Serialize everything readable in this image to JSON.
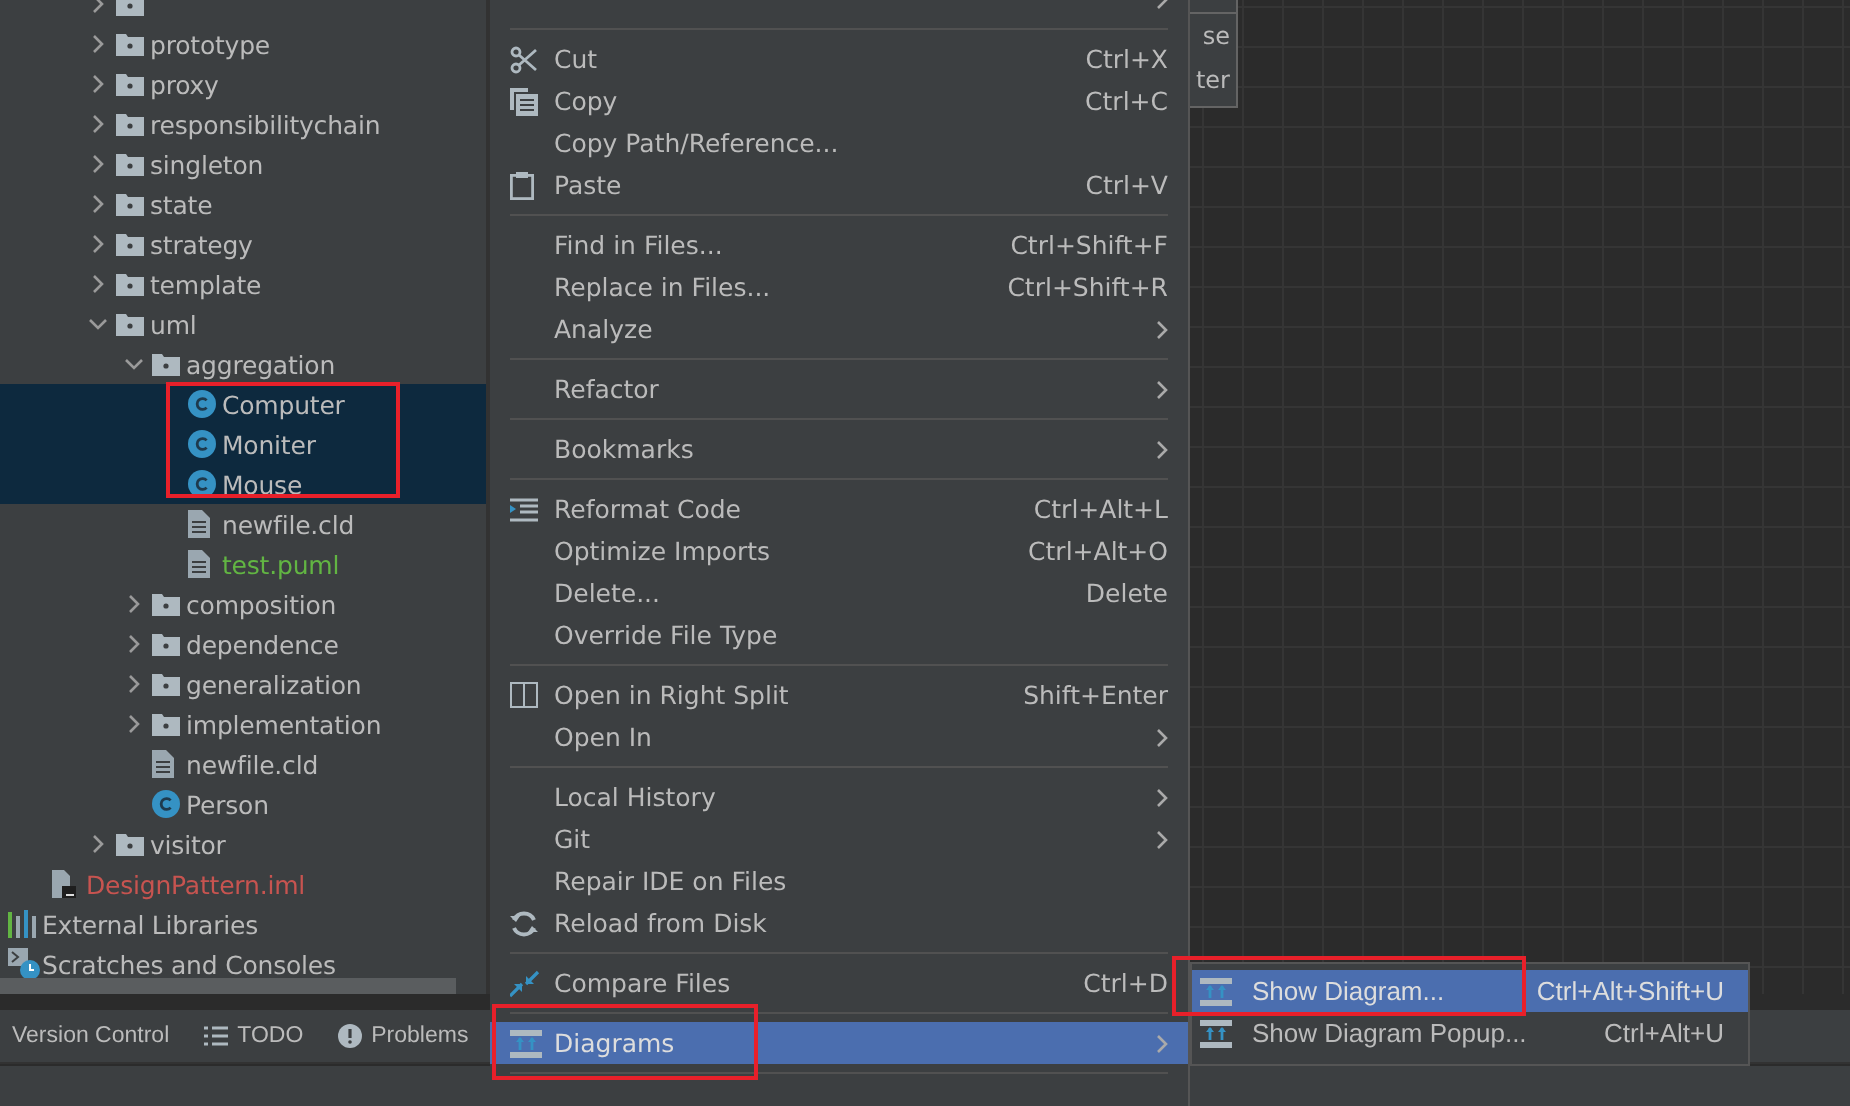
{
  "project_tree": {
    "package_items": [
      {
        "kind": "folder",
        "expanded": false,
        "selected": false
      },
      {
        "label": "prototype",
        "kind": "folder",
        "expanded": false,
        "selected": false
      },
      {
        "label": "proxy",
        "kind": "folder",
        "expanded": false,
        "selected": false
      },
      {
        "label": "responsibilitychain",
        "kind": "folder",
        "expanded": false,
        "selected": false
      },
      {
        "label": "singleton",
        "kind": "folder",
        "expanded": false,
        "selected": false
      },
      {
        "label": "state",
        "kind": "folder",
        "expanded": false,
        "selected": false
      },
      {
        "label": "strategy",
        "kind": "folder",
        "expanded": false,
        "selected": false
      },
      {
        "label": "template",
        "kind": "folder",
        "expanded": false,
        "selected": false
      },
      {
        "label": "uml",
        "kind": "folder",
        "expanded": true,
        "selected": false,
        "children": [
          {
            "label": "aggregation",
            "kind": "folder",
            "expanded": true,
            "selected": false,
            "children": [
              {
                "label": "Computer",
                "kind": "class",
                "selected": true
              },
              {
                "label": "Moniter",
                "kind": "class",
                "selected": true
              },
              {
                "label": "Mouse",
                "kind": "class",
                "selected": true
              },
              {
                "label": "newfile.cld",
                "kind": "file",
                "selected": false
              },
              {
                "label": "test.puml",
                "kind": "file",
                "selected": false,
                "color": "#62b543"
              }
            ]
          },
          {
            "label": "composition",
            "kind": "folder",
            "expanded": false,
            "selected": false
          },
          {
            "label": "dependence",
            "kind": "folder",
            "expanded": false,
            "selected": false
          },
          {
            "label": "generalization",
            "kind": "folder",
            "expanded": false,
            "selected": false
          },
          {
            "label": "implementation",
            "kind": "folder",
            "expanded": false,
            "selected": false
          },
          {
            "label": "newfile.cld",
            "kind": "file",
            "selected": false
          },
          {
            "label": "Person",
            "kind": "class",
            "selected": false
          }
        ]
      },
      {
        "label": "visitor",
        "kind": "folder",
        "expanded": false,
        "selected": false
      }
    ],
    "module_file": {
      "label": "DesignPattern.iml",
      "kind": "module",
      "selected": false,
      "color": "#c75450"
    },
    "root_items": [
      {
        "label": "External Libraries",
        "kind": "libraries",
        "selected": false
      },
      {
        "label": "Scratches and Consoles",
        "kind": "scratches",
        "selected": false
      }
    ]
  },
  "canvas_popup": {
    "lines": [
      "se",
      "ter"
    ]
  },
  "tool_window_bar": {
    "tabs": [
      {
        "label": "Version Control"
      },
      {
        "label": "TODO"
      },
      {
        "label": "Problems"
      }
    ]
  },
  "context_menu": {
    "items": [
      {
        "kind": "item",
        "submenu": true,
        "selected": false
      },
      {
        "kind": "separator"
      },
      {
        "kind": "item",
        "label": "Cut",
        "shortcut": "Ctrl+X",
        "submenu": false,
        "selected": false
      },
      {
        "kind": "item",
        "label": "Copy",
        "shortcut": "Ctrl+C",
        "submenu": false,
        "selected": false
      },
      {
        "kind": "item",
        "label": "Copy Path/Reference...",
        "submenu": false,
        "selected": false
      },
      {
        "kind": "item",
        "label": "Paste",
        "shortcut": "Ctrl+V",
        "submenu": false,
        "selected": false
      },
      {
        "kind": "separator"
      },
      {
        "kind": "item",
        "label": "Find in Files...",
        "shortcut": "Ctrl+Shift+F",
        "submenu": false,
        "selected": false
      },
      {
        "kind": "item",
        "label": "Replace in Files...",
        "shortcut": "Ctrl+Shift+R",
        "submenu": false,
        "selected": false
      },
      {
        "kind": "item",
        "label": "Analyze",
        "submenu": true,
        "selected": false
      },
      {
        "kind": "separator"
      },
      {
        "kind": "item",
        "label": "Refactor",
        "submenu": true,
        "selected": false
      },
      {
        "kind": "separator"
      },
      {
        "kind": "item",
        "label": "Bookmarks",
        "submenu": true,
        "selected": false
      },
      {
        "kind": "separator"
      },
      {
        "kind": "item",
        "label": "Reformat Code",
        "shortcut": "Ctrl+Alt+L",
        "submenu": false,
        "selected": false
      },
      {
        "kind": "item",
        "label": "Optimize Imports",
        "shortcut": "Ctrl+Alt+O",
        "submenu": false,
        "selected": false
      },
      {
        "kind": "item",
        "label": "Delete...",
        "shortcut": "Delete",
        "submenu": false,
        "selected": false
      },
      {
        "kind": "item",
        "label": "Override File Type",
        "submenu": false,
        "selected": false
      },
      {
        "kind": "separator"
      },
      {
        "kind": "item",
        "label": "Open in Right Split",
        "shortcut": "Shift+Enter",
        "submenu": false,
        "selected": false
      },
      {
        "kind": "item",
        "label": "Open In",
        "submenu": true,
        "selected": false
      },
      {
        "kind": "separator"
      },
      {
        "kind": "item",
        "label": "Local History",
        "submenu": true,
        "selected": false
      },
      {
        "kind": "item",
        "label": "Git",
        "submenu": true,
        "selected": false
      },
      {
        "kind": "item",
        "label": "Repair IDE on Files",
        "submenu": false,
        "selected": false
      },
      {
        "kind": "item",
        "label": "Reload from Disk",
        "submenu": false,
        "selected": false
      },
      {
        "kind": "separator"
      },
      {
        "kind": "item",
        "label": "Compare Files",
        "shortcut": "Ctrl+D",
        "submenu": false,
        "selected": false
      },
      {
        "kind": "separator"
      },
      {
        "kind": "item",
        "label": "Diagrams",
        "submenu": true,
        "selected": true
      },
      {
        "kind": "separator"
      }
    ]
  },
  "diagrams_submenu": {
    "items": [
      {
        "label": "Show Diagram...",
        "shortcut": "Ctrl+Alt+Shift+U",
        "selected": true
      },
      {
        "label": "Show Diagram Popup...",
        "shortcut": "Ctrl+Alt+U",
        "selected": false
      }
    ]
  }
}
